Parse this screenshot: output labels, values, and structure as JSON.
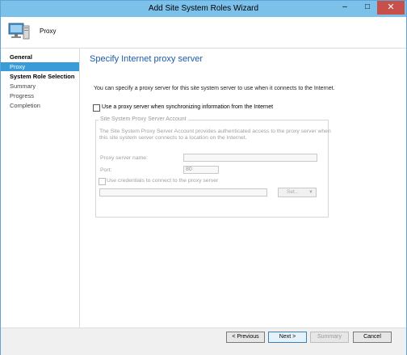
{
  "window": {
    "title": "Add Site System Roles Wizard",
    "minimize": "–",
    "maximize": "□",
    "close": "✕"
  },
  "header": {
    "label": "Proxy"
  },
  "sidebar": {
    "items": [
      {
        "label": "General"
      },
      {
        "label": "Proxy"
      },
      {
        "label": "System Role Selection"
      },
      {
        "label": "Summary"
      },
      {
        "label": "Progress"
      },
      {
        "label": "Completion"
      }
    ]
  },
  "main": {
    "title": "Specify Internet proxy server",
    "description": "You can specify a proxy server for this site system server to use when it connects to the Internet.",
    "use_proxy_label": "Use a proxy server when synchronizing information from the Internet",
    "group": {
      "title": "Site System Proxy Server Account",
      "text_line1": "The Site System Proxy Server Account provides authenticated access to the proxy server when",
      "text_line2": "this site system server connects to a location on the Internet.",
      "proxy_name_label": "Proxy server name:",
      "proxy_name_value": "",
      "port_label": "Port:",
      "port_value": "80",
      "credentials_label": "Use credentials to connect to the proxy server",
      "account_value": "",
      "set_label": "Set..."
    }
  },
  "footer": {
    "previous": "< Previous",
    "next": "Next >",
    "summary": "Summary",
    "cancel": "Cancel"
  }
}
